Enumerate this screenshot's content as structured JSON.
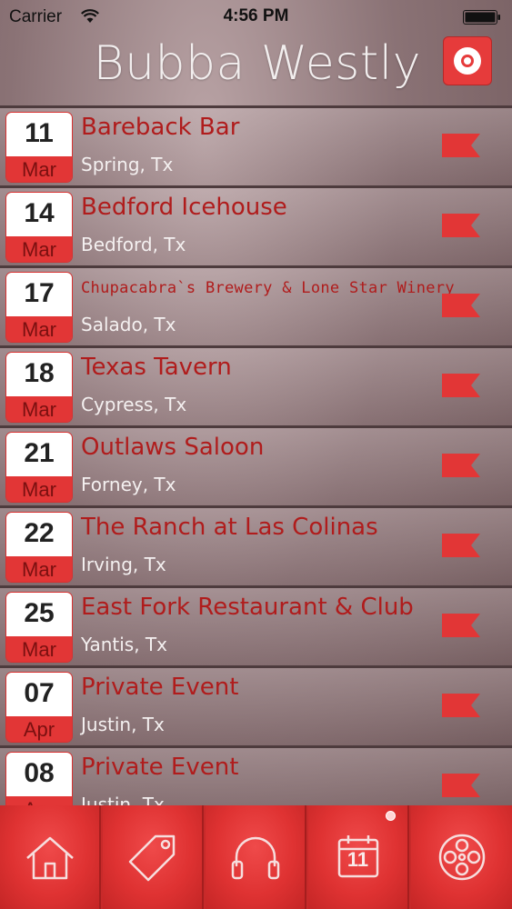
{
  "status_bar": {
    "carrier": "Carrier",
    "time": "4:56 PM"
  },
  "header": {
    "title": "Bubba Westly",
    "record_icon": "record-icon"
  },
  "events": [
    {
      "day": "11",
      "month": "Mar",
      "venue": "Bareback Bar",
      "city": "Spring, Tx"
    },
    {
      "day": "14",
      "month": "Mar",
      "venue": "Bedford Icehouse",
      "city": "Bedford, Tx"
    },
    {
      "day": "17",
      "month": "Mar",
      "venue": "Chupacabra`s Brewery & Lone Star Winery",
      "city": "Salado, Tx"
    },
    {
      "day": "18",
      "month": "Mar",
      "venue": "Texas Tavern",
      "city": "Cypress, Tx"
    },
    {
      "day": "21",
      "month": "Mar",
      "venue": "Outlaws Saloon",
      "city": "Forney, Tx"
    },
    {
      "day": "22",
      "month": "Mar",
      "venue": "The Ranch at Las Colinas",
      "city": "Irving, Tx"
    },
    {
      "day": "25",
      "month": "Mar",
      "venue": "East Fork Restaurant & Club",
      "city": "Yantis, Tx"
    },
    {
      "day": "07",
      "month": "Apr",
      "venue": "Private Event",
      "city": "Justin, Tx"
    },
    {
      "day": "08",
      "month": "Apr",
      "venue": "Private Event",
      "city": "Justin, Tx"
    }
  ],
  "tabs": [
    {
      "icon": "home-icon"
    },
    {
      "icon": "tag-icon"
    },
    {
      "icon": "headphones-icon"
    },
    {
      "icon": "calendar-icon",
      "label": "11",
      "selected": true
    },
    {
      "icon": "film-reel-icon"
    }
  ],
  "colors": {
    "accent": "#e23636",
    "venue_text": "#b01c1c",
    "city_text": "#f4f0f0"
  }
}
